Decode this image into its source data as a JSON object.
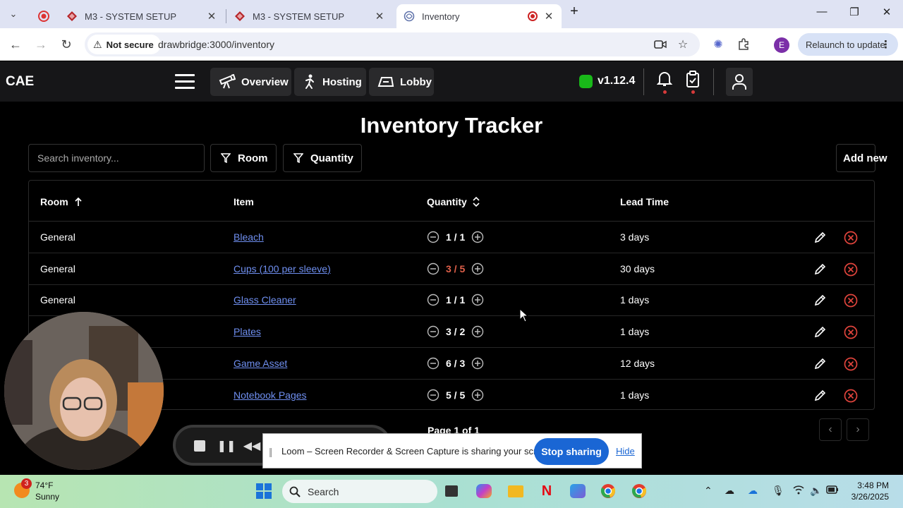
{
  "browser": {
    "tabs": [
      {
        "title": ""
      },
      {
        "title": "M3 - SYSTEM SETUP"
      },
      {
        "title": "M3 - SYSTEM SETUP"
      },
      {
        "title": "Inventory"
      }
    ],
    "security_label": "Not secure",
    "url": "drawbridge:3000/inventory",
    "profile_initial": "E",
    "relaunch_label": "Relaunch to update"
  },
  "app": {
    "brand": "CAE",
    "nav": [
      {
        "label": "Overview",
        "icon": "telescope-icon"
      },
      {
        "label": "Hosting",
        "icon": "person-running-icon"
      },
      {
        "label": "Lobby",
        "icon": "lobby-icon"
      }
    ],
    "version": "v1.12.4",
    "status_color": "#19b919"
  },
  "page": {
    "title": "Inventory Tracker",
    "search_placeholder": "Search inventory...",
    "filters": [
      "Room",
      "Quantity"
    ],
    "add_new_label": "Add new"
  },
  "table": {
    "columns": [
      "Room",
      "Item",
      "Quantity",
      "Lead Time"
    ],
    "rows": [
      {
        "room": "General",
        "item": "Bleach",
        "quantity": "1 / 1",
        "low": false,
        "lead_time": "3 days"
      },
      {
        "room": "General",
        "item": "Cups (100 per sleeve)",
        "quantity": "3 / 5",
        "low": true,
        "lead_time": "30 days"
      },
      {
        "room": "General",
        "item": "Glass Cleaner",
        "quantity": "1 / 1",
        "low": false,
        "lead_time": "1 days"
      },
      {
        "room": "",
        "item": "Plates",
        "quantity": "3 / 2",
        "low": false,
        "lead_time": "1 days"
      },
      {
        "room": "",
        "item": "Game Asset",
        "quantity": "6 / 3",
        "low": false,
        "lead_time": "12 days"
      },
      {
        "room": "",
        "item": "Notebook Pages",
        "quantity": "5 / 5",
        "low": false,
        "lead_time": "1 days"
      }
    ],
    "pagination": "Page 1 of 1"
  },
  "loom": {
    "message": "Loom – Screen Recorder & Screen Capture is sharing your screen.",
    "stop_label": "Stop sharing",
    "hide_label": "Hide"
  },
  "taskbar": {
    "weather_badge": "3",
    "temperature": "74°F",
    "condition": "Sunny",
    "search_placeholder": "Search",
    "time": "3:48 PM",
    "date": "3/26/2025"
  },
  "colors": {
    "accent_link": "#6f8ff0",
    "low_stock": "#e0604a",
    "delete": "#e0443c"
  }
}
